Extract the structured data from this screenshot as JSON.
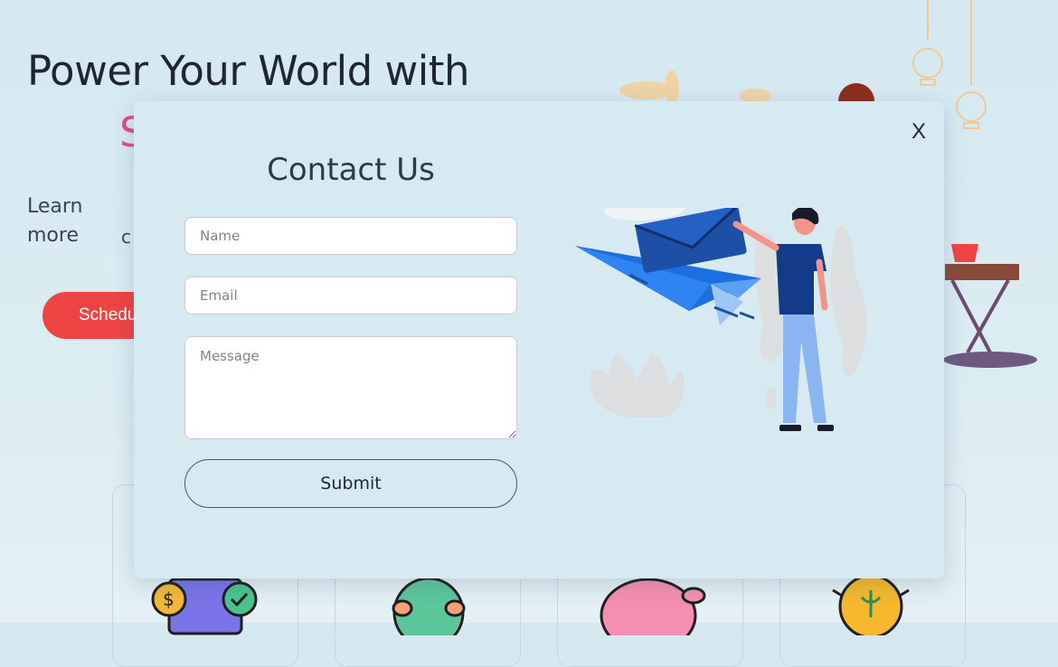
{
  "hero": {
    "title": "Power Your World with",
    "accent": "S",
    "subtitle": "Learn more",
    "subtitle_line2": "c",
    "cta_label": "Schedu"
  },
  "modal": {
    "close_label": "X",
    "title": "Contact Us",
    "fields": {
      "name_placeholder": "Name",
      "email_placeholder": "Email",
      "message_placeholder": "Message"
    },
    "submit_label": "Submit"
  },
  "colors": {
    "accent_pink": "#e2498a",
    "cta_red": "#ef4444",
    "envelope_blue": "#1e63c6",
    "modal_bg": "#d7e9f1"
  },
  "icons": [
    "money-check-icon",
    "globe-icon",
    "piggy-bank-icon",
    "lightbulb-icon"
  ]
}
